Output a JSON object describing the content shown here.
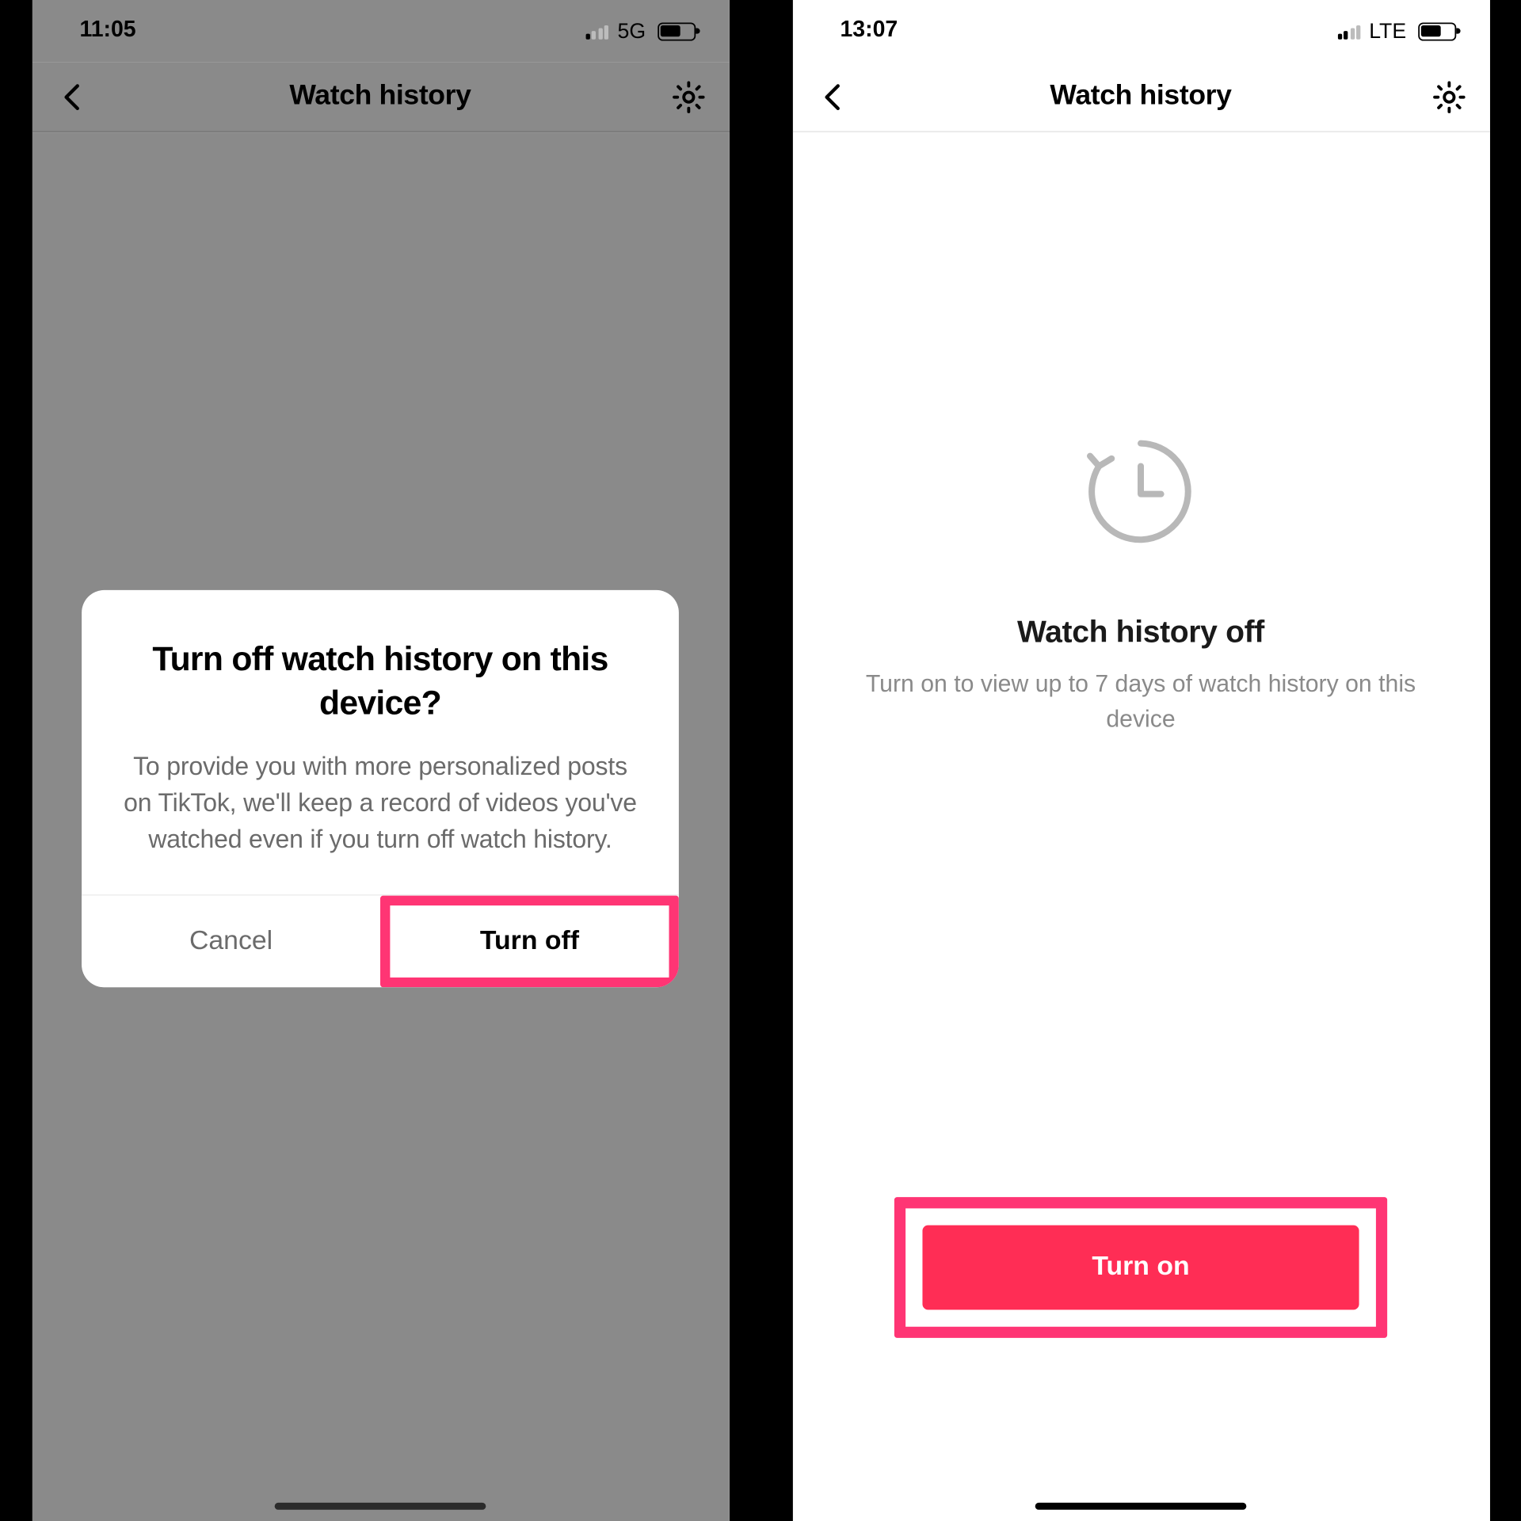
{
  "left": {
    "status": {
      "time": "11:05",
      "network": "5G",
      "signal_bars": 1
    },
    "header": {
      "title": "Watch history"
    },
    "modal": {
      "title": "Turn off watch history on this device?",
      "body": "To provide you with more personalized posts on TikTok, we'll keep a record of videos you've watched even if you turn off watch history.",
      "cancel_label": "Cancel",
      "confirm_label": "Turn off"
    }
  },
  "right": {
    "status": {
      "time": "13:07",
      "network": "LTE",
      "signal_bars": 2
    },
    "header": {
      "title": "Watch history"
    },
    "empty": {
      "title": "Watch history off",
      "body": "Turn on to view up to 7 days of watch history on this device",
      "button_label": "Turn on"
    }
  }
}
